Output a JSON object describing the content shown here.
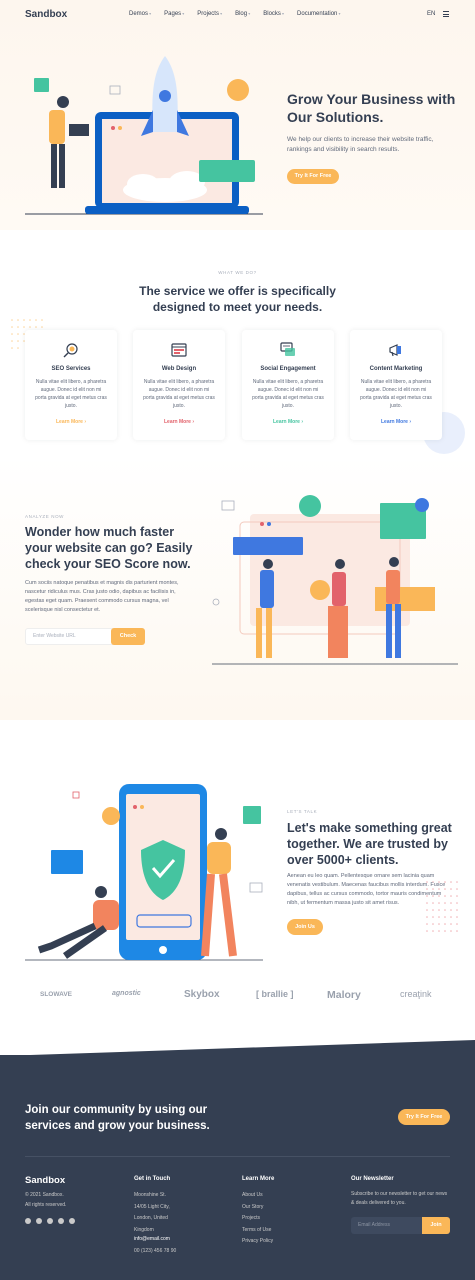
{
  "header": {
    "logo": "Sandbox",
    "nav": [
      "Demos",
      "Pages",
      "Projects",
      "Blog",
      "Blocks",
      "Documentation"
    ],
    "lang": "EN"
  },
  "hero": {
    "title": "Grow Your Business with Our Solutions.",
    "subtitle": "We help our clients to increase their website traffic, rankings and visibility in search results.",
    "cta": "Try It For Free"
  },
  "services": {
    "eyebrow": "WHAT WE DO?",
    "title": "The service we offer is specifically designed to meet your needs.",
    "cards": [
      {
        "title": "SEO Services",
        "desc": "Nulla vitae elit libero, a pharetra augue. Donec id elit non mi porta gravida at eget metus cras justo.",
        "link": "Learn More",
        "color": "#fab758",
        "icon": "seo-search-icon"
      },
      {
        "title": "Web Design",
        "desc": "Nulla vitae elit libero, a pharetra augue. Donec id elit non mi porta gravida at eget metus cras justo.",
        "link": "Learn More",
        "color": "#e2626b",
        "icon": "web-design-icon"
      },
      {
        "title": "Social Engagement",
        "desc": "Nulla vitae elit libero, a pharetra augue. Donec id elit non mi porta gravida at eget metus cras justo.",
        "link": "Learn More",
        "color": "#45c4a0",
        "icon": "social-chat-icon"
      },
      {
        "title": "Content Marketing",
        "desc": "Nulla vitae elit libero, a pharetra augue. Donec id elit non mi porta gravida at eget metus cras justo.",
        "link": "Learn More",
        "color": "#3f78e0",
        "icon": "megaphone-icon"
      }
    ]
  },
  "analyze": {
    "eyebrow": "ANALYZE NOW",
    "title": "Wonder how much faster your website can go? Easily check your SEO Score now.",
    "desc": "Cum sociis natoque penatibus et magnis dis parturient montes, nascetur ridiculus mus. Cras justo odio, dapibus ac facilisis in, egestas eget quam. Praesent commodo cursus magna, vel scelerisque nisl consectetur et.",
    "input_placeholder": "Enter Website URL",
    "button": "Check"
  },
  "talk": {
    "eyebrow": "LET'S TALK",
    "title": "Let's make something great together. We are trusted by over 5000+ clients.",
    "desc": "Aenean eu leo quam. Pellentesque ornare sem lacinia quam venenatis vestibulum. Maecenas faucibus mollis interdum. Fusce dapibus, tellus ac cursus commodo, tortor mauris condimentum nibh, ut fermentum massa justo sit amet risus.",
    "button": "Join Us"
  },
  "clients": [
    "SLOWAVE",
    "agnostic",
    "Skybox",
    "[ brallie ]",
    "Malory",
    "creaţink"
  ],
  "cta": {
    "title": "Join our community by using our services and grow your business.",
    "button": "Try It For Free"
  },
  "footer": {
    "logo": "Sandbox",
    "copyright": "© 2021 Sandbox.",
    "rights": "All rights reserved.",
    "get_in_touch": {
      "heading": "Get in Touch",
      "address": [
        "Moonshine St.",
        "14/05 Light City,",
        "London, United",
        "Kingdom"
      ],
      "email": "info@email.com",
      "phone": "00 (123) 456 78 90"
    },
    "learn_more": {
      "heading": "Learn More",
      "links": [
        "About Us",
        "Our Story",
        "Projects",
        "Terms of Use",
        "Privacy Policy"
      ]
    },
    "newsletter": {
      "heading": "Our Newsletter",
      "desc": "Subscribe to our newsletter to get our news & deals delivered to you.",
      "placeholder": "Email Address",
      "button": "Join"
    }
  },
  "colors": {
    "accent": "#fab758",
    "primary": "#3f78e0",
    "dark": "#343f52",
    "green": "#45c4a0",
    "red": "#e2626b"
  }
}
